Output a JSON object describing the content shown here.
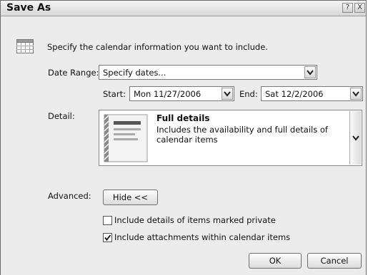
{
  "window": {
    "title": "Save As",
    "help_glyph": "?",
    "close_glyph": "X"
  },
  "intro": {
    "text": "Specify the calendar information you want to include.",
    "icon": "calendar-icon"
  },
  "date_range": {
    "label": "Date Range:",
    "value": "Specify dates..."
  },
  "start": {
    "label": "Start:",
    "value": "Mon 11/27/2006"
  },
  "end": {
    "label": "End:",
    "value": "Sat 12/2/2006"
  },
  "detail": {
    "label": "Detail:",
    "option_title": "Full details",
    "option_description": "Includes the availability and full details of calendar items",
    "icon": "details-document-icon"
  },
  "advanced": {
    "label": "Advanced:",
    "toggle_label": "Hide <<"
  },
  "options": [
    {
      "label": "Include details of items marked private",
      "checked": false
    },
    {
      "label": "Include attachments within calendar items",
      "checked": true
    }
  ],
  "buttons": {
    "ok": "OK",
    "cancel": "Cancel"
  }
}
